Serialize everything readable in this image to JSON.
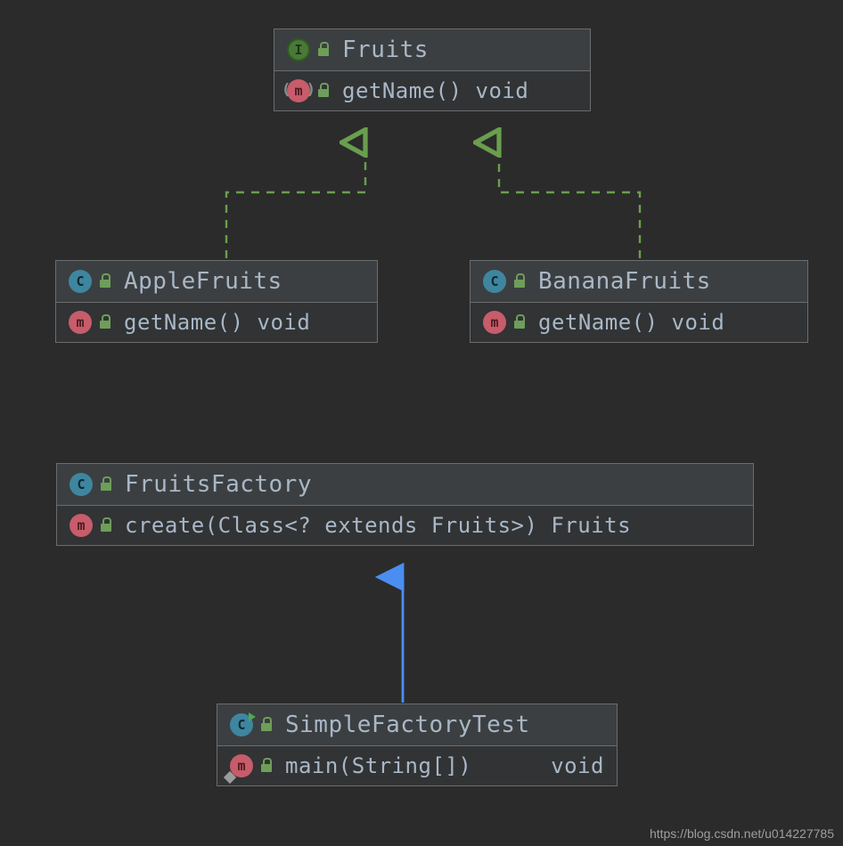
{
  "diagram": {
    "fruits": {
      "name": "Fruits",
      "type_icon": "I",
      "method": {
        "sig": "getName() void",
        "icon": "m"
      }
    },
    "apple": {
      "name": "AppleFruits",
      "type_icon": "C",
      "method": {
        "sig": "getName() void",
        "icon": "m"
      }
    },
    "banana": {
      "name": "BananaFruits",
      "type_icon": "C",
      "method": {
        "sig": "getName() void",
        "icon": "m"
      }
    },
    "factory": {
      "name": "FruitsFactory",
      "type_icon": "C",
      "method": {
        "sig": "create(Class<? extends Fruits>)  Fruits",
        "icon": "m"
      }
    },
    "test": {
      "name": "SimpleFactoryTest",
      "type_icon": "C",
      "method": {
        "left": "main(String[])",
        "right": "void",
        "icon": "m"
      }
    }
  },
  "watermark": "https://blog.csdn.net/u014227785",
  "colors": {
    "implements_arrow": "#6a9e4d",
    "uses_arrow": "#4a8ff0"
  }
}
